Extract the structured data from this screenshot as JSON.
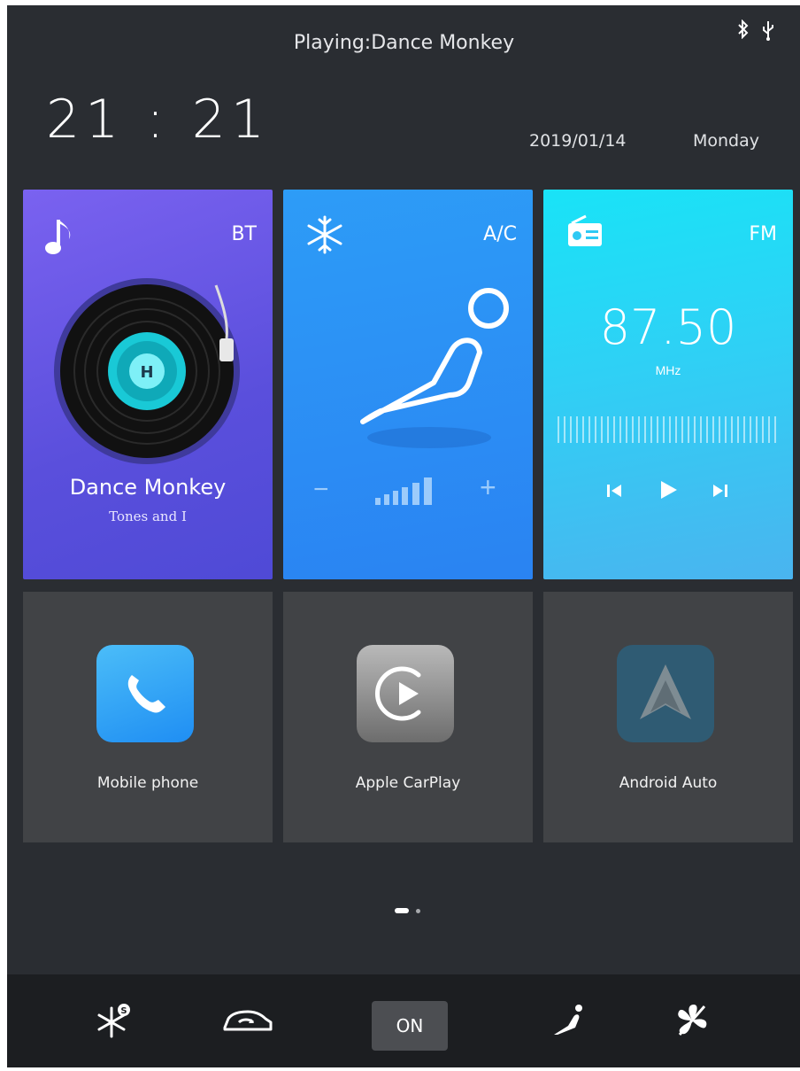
{
  "status": {
    "now_playing": "Playing:Dance Monkey",
    "icons": [
      "bluetooth-icon",
      "usb-icon"
    ]
  },
  "clock": {
    "time": "21 : 21",
    "date": "2019/01/14",
    "weekday": "Monday"
  },
  "cards": {
    "bt": {
      "tag": "BT",
      "song": "Dance Monkey",
      "artist": "Tones and I",
      "icon": "music-note-icon"
    },
    "ac": {
      "tag": "A/C",
      "icon": "snowflake-icon",
      "minus": "−",
      "plus": "+"
    },
    "fm": {
      "tag": "FM",
      "frequency": "87.50",
      "unit": "MHz",
      "icon": "radio-icon"
    }
  },
  "apps": [
    {
      "label": "Mobile phone",
      "icon": "phone-icon"
    },
    {
      "label": "Apple CarPlay",
      "icon": "carplay-icon"
    },
    {
      "label": "Android Auto",
      "icon": "android-auto-icon"
    }
  ],
  "pager": {
    "pages": 2,
    "current": 1
  },
  "dock": {
    "on_label": "ON",
    "icons": [
      "defrost-icon",
      "car-recirculation-icon",
      "seat-heat-icon",
      "fan-off-icon"
    ]
  },
  "colors": {
    "bt_card": "#5a4fdc",
    "ac_card": "#2a83f2",
    "fm_card": "#2fd0f5",
    "tile": "#414346",
    "background": "#2a2d32"
  }
}
